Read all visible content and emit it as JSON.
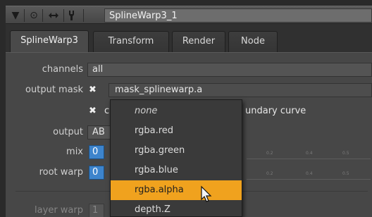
{
  "node": {
    "name": "SplineWarp3_1"
  },
  "tabs": [
    {
      "label": "SplineWarp3",
      "active": true
    },
    {
      "label": "Transform",
      "active": false
    },
    {
      "label": "Render",
      "active": false
    },
    {
      "label": "Node",
      "active": false
    }
  ],
  "params": {
    "channels": {
      "label": "channels",
      "value": "all"
    },
    "output_mask": {
      "label": "output mask",
      "checked": "✖",
      "value": "mask_splinewarp.a"
    },
    "option_row": {
      "checked": "✖",
      "label_left": "c",
      "label_right": "undary curve"
    },
    "output": {
      "label": "output",
      "value": "AB"
    },
    "mix": {
      "label": "mix",
      "value": "0"
    },
    "root_warp": {
      "label": "root warp",
      "value": "0"
    },
    "layer_warp": {
      "label": "layer warp",
      "value": "1"
    }
  },
  "slider_ticks": [
    "0.2",
    "0.4",
    "0.5"
  ],
  "dropdown": {
    "items": [
      {
        "label": "none",
        "style": "italic"
      },
      {
        "label": "rgba.red"
      },
      {
        "label": "rgba.green"
      },
      {
        "label": "rgba.blue"
      },
      {
        "label": "rgba.alpha",
        "highlighted": true
      },
      {
        "label": "depth.Z"
      }
    ]
  },
  "colors": {
    "highlight": "#f0a21e",
    "number_field": "#3d84cc",
    "panel": "#474747"
  }
}
